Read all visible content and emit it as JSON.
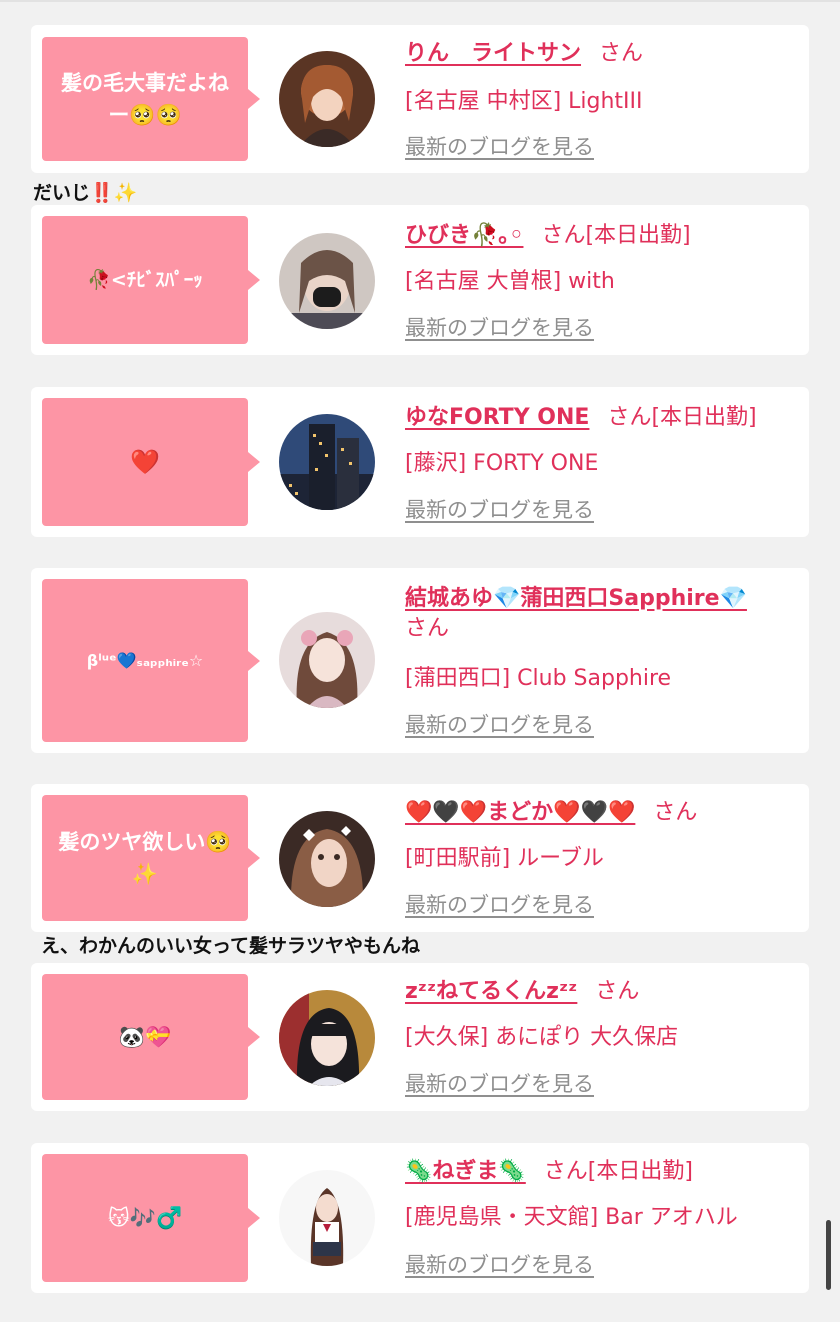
{
  "colors": {
    "accent": "#e0305a",
    "bubble": "#fd95a5",
    "link_gray": "#8f8f8f"
  },
  "cards": [
    {
      "bubble": "髪の毛大事だよね ー🥺🥺",
      "name": "りん　ライトサン",
      "suffix": "さん",
      "shop": "[名古屋 中村区] LightIII",
      "blog": "最新のブログを見る"
    },
    {
      "bubble": "🥀<ﾁﾋﾞｽﾊﾟｰｯ",
      "name": "ひびき🥀｡◦",
      "suffix": "さん[本日出勤]",
      "shop": "[名古屋 大曽根] with",
      "blog": "最新のブログを見る"
    },
    {
      "bubble": "❤️",
      "name": "ゆなFORTY ONE",
      "suffix": "さん[本日出勤]",
      "shop": "[藤沢] FORTY ONE",
      "blog": "最新のブログを見る"
    },
    {
      "bubble": "βˡᵘᵉ💙ₛₐₚₚₕᵢᵣₑ☆",
      "name": "結城あゆ💎蒲田西口Sapphire💎",
      "suffix": "さん",
      "shop": "[蒲田西口] Club Sapphire",
      "blog": "最新のブログを見る"
    },
    {
      "bubble": "髪のツヤ欲しい🥺 ✨",
      "name": "❤️🖤❤️まどか❤️🖤❤️",
      "suffix": "さん",
      "shop": "[町田駅前] ルーブル",
      "blog": "最新のブログを見る"
    },
    {
      "bubble": "🐼💝",
      "name": "zᶻᶻねてるくんzᶻᶻ",
      "suffix": "さん",
      "shop": "[大久保] あにぽり 大久保店",
      "blog": "最新のブログを見る"
    },
    {
      "bubble": "😽🎶♂️",
      "name": "🦠ねぎま🦠",
      "suffix": "さん[本日出勤]",
      "shop": "[鹿児島県・天文館] Bar アオハル",
      "blog": "最新のブログを見る"
    }
  ],
  "comments": {
    "c1": "だいじ‼️✨",
    "c2": "え、わかんのいい女って髪サラツヤやもんね"
  }
}
